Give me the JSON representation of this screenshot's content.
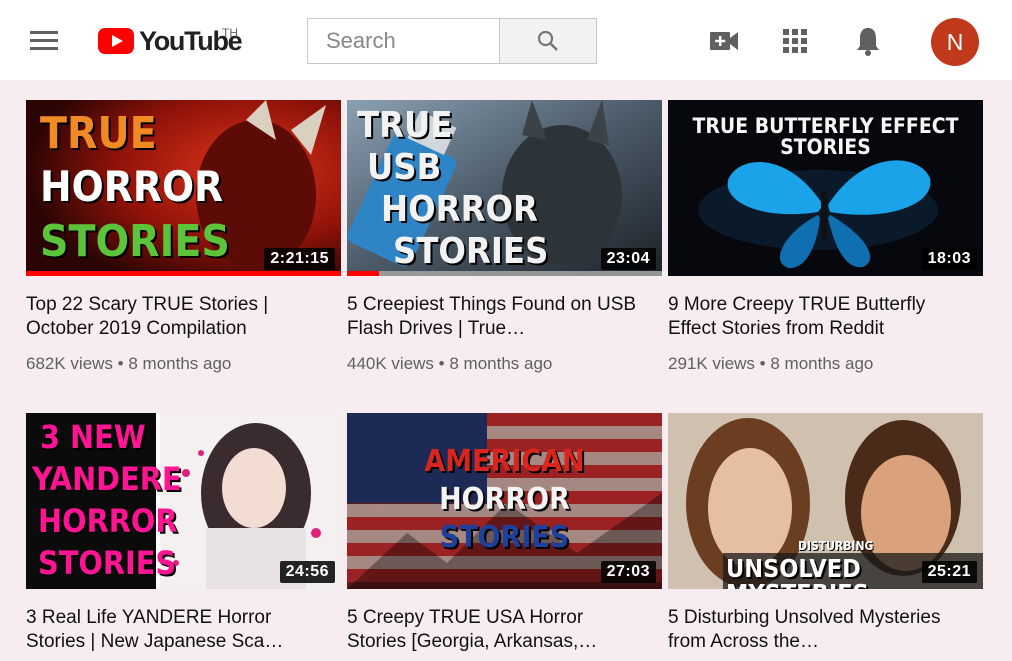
{
  "header": {
    "logo_text": "YouTube",
    "region": "TH",
    "search_placeholder": "Search",
    "avatar_letter": "N",
    "icons": [
      "menu-icon",
      "create-video-icon",
      "apps-grid-icon",
      "notifications-bell-icon",
      "search-icon"
    ]
  },
  "colors": {
    "brand_red": "#ff0000",
    "avatar_bg": "#c1391b",
    "page_bg": "#f7edf0"
  },
  "videos": [
    {
      "title": "Top 22 Scary TRUE Stories | October 2019 Compilation",
      "views": "682K views",
      "age": "8 months ago",
      "duration": "2:21:15",
      "watched_fraction": 1.0,
      "thumb_text": [
        "TRUE",
        "HORROR",
        "STORIES"
      ]
    },
    {
      "title": "5 Creepiest Things Found on USB Flash Drives | True…",
      "views": "440K views",
      "age": "8 months ago",
      "duration": "23:04",
      "watched_fraction": 0.1,
      "thumb_text": [
        "TRUE",
        "USB",
        "HORROR",
        "STORIES"
      ]
    },
    {
      "title": "9 More Creepy TRUE Butterfly Effect Stories from Reddit",
      "views": "291K views",
      "age": "8 months ago",
      "duration": "18:03",
      "watched_fraction": null,
      "thumb_text": [
        "TRUE BUTTERFLY EFFECT STORIES"
      ]
    },
    {
      "title": "3 Real Life YANDERE Horror Stories | New Japanese Sca…",
      "views": "",
      "age": "",
      "duration": "24:56",
      "watched_fraction": null,
      "thumb_text": [
        "3 NEW",
        "YANDERE",
        "HORROR",
        "STORIES"
      ]
    },
    {
      "title": "5 Creepy TRUE USA Horror Stories [Georgia, Arkansas,…",
      "views": "",
      "age": "",
      "duration": "27:03",
      "watched_fraction": null,
      "thumb_text": [
        "AMERICAN",
        "HORROR",
        "STORIES"
      ]
    },
    {
      "title": "5 Disturbing Unsolved Mysteries from Across the…",
      "views": "",
      "age": "",
      "duration": "25:21",
      "watched_fraction": null,
      "thumb_text": [
        "DISTURBING",
        "UNSOLVED MYSTERIES"
      ]
    }
  ]
}
